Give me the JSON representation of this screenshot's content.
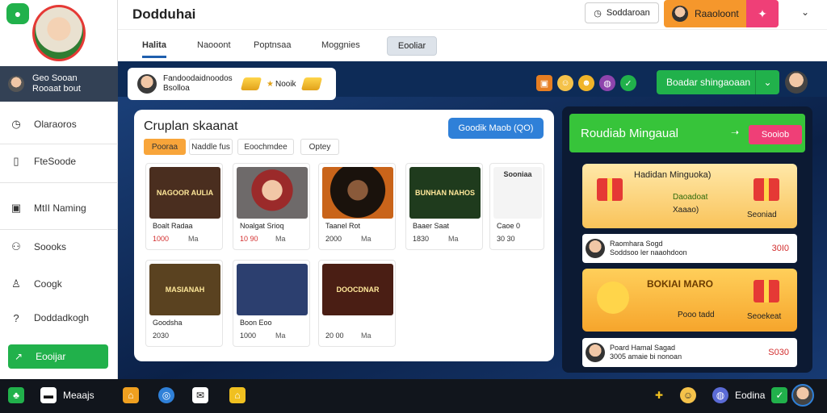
{
  "app": {
    "title": "Dodduhai",
    "logo_icon": "chat-bubble-icon"
  },
  "sidebar": {
    "user": {
      "line1": "Geo Sooan",
      "line2": "Rooaat bout"
    },
    "items": [
      {
        "label": "Olaraoros",
        "icon": "clock-icon"
      },
      {
        "label": "FteSoode",
        "icon": "phone-icon"
      },
      {
        "label": "MtII Naming",
        "icon": "picture-icon"
      },
      {
        "label": "Soooks",
        "icon": "user-icon"
      },
      {
        "label": "Coogk",
        "icon": "person-icon"
      },
      {
        "label": "Doddadkogh",
        "icon": "help-icon"
      }
    ],
    "active_item": {
      "label": "Eooijar",
      "icon": "arrow-icon"
    }
  },
  "topbar": {
    "search_label": "Soddaroan",
    "account_label": "Raaoloont"
  },
  "tabs": [
    "Halita",
    "Naooont",
    "Poptnsaa",
    "Moggnies"
  ],
  "tab_button": "Eooliar",
  "infobar": {
    "title": "Fandoodaidnoodos",
    "subtitle": "Bsolloa",
    "star_label": "Nooik"
  },
  "green_button": "Boadar shingaoaan",
  "panel": {
    "title": "Cruplan skaanat",
    "button": "Goodik Maob (QO)",
    "chips": [
      "Pooraa",
      "Naddle fus",
      "Eoochmdee",
      "Optey"
    ],
    "cards": [
      {
        "thumb": "NAGOOR AULIA",
        "name": "Boalt Radaa",
        "price": "1000",
        "unit": "Ma",
        "color": "#4a2e1f"
      },
      {
        "thumb": "",
        "name": "Noalgat Srioq",
        "price": "10 90",
        "unit": "Ma",
        "color": "#8a6f6a"
      },
      {
        "thumb": "",
        "name": "Taanel Rot",
        "price": "2000",
        "unit": "Ma",
        "color": "#2a1a10"
      },
      {
        "thumb": "BUNHAN NAHOS",
        "name": "Baaer Saat",
        "price": "1830",
        "unit": "Ma",
        "color": "#1f3b1d"
      },
      {
        "thumb": "Sooniaa",
        "name": "Caoe 0",
        "price": "30 30",
        "unit": "",
        "color": "#f0f0f0"
      },
      {
        "thumb": "MASIANAH",
        "name": "Goodsha",
        "price": "2030",
        "unit": "",
        "color": "#5a4220"
      },
      {
        "thumb": "",
        "name": "Boon Eoo",
        "price": "1000",
        "unit": "Ma",
        "color": "#2c3f6f"
      },
      {
        "thumb": "DOOCDNAR",
        "name": "",
        "price": "20 00",
        "unit": "Ma",
        "color": "#4a1e14"
      }
    ]
  },
  "right_panel": {
    "title": "Roudiab Mingaual",
    "button": "Sooiob",
    "promo1": {
      "title": "Hadidan Minguoka)",
      "line1": "Daoadoat",
      "line2": "Xaaao)",
      "label": "Seoniad"
    },
    "row1": {
      "title": "Raomhara Sogd",
      "sub": "Soddsoo ler naaohdoon",
      "price": "30I0"
    },
    "promo2": {
      "title": "BOKIAI MARO",
      "label": "Pooo tadd",
      "label2": "Seoekeat"
    },
    "row2": {
      "title": "Poard Hamal Sagad",
      "sub": "3005 amaie bi nonoan",
      "price": "S030"
    }
  },
  "taskbar": {
    "item1": "Meaajs",
    "item2": "Eodina"
  }
}
